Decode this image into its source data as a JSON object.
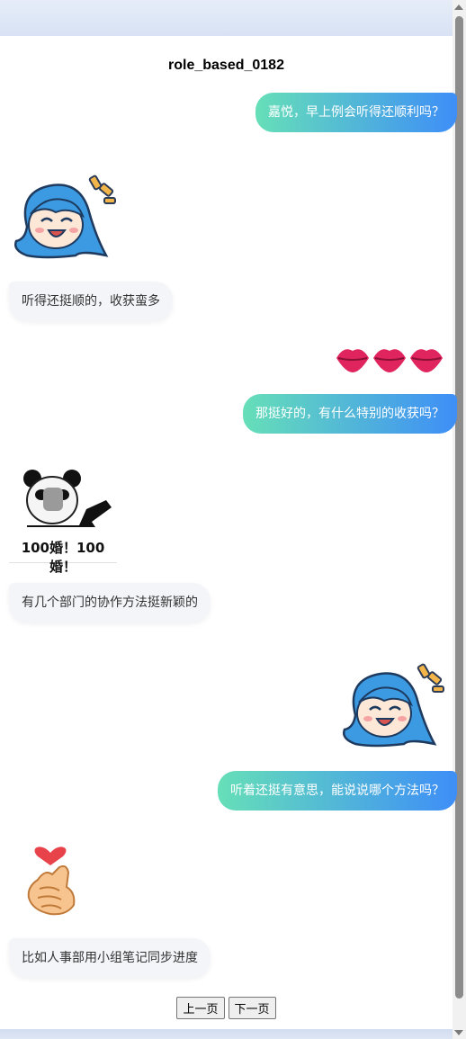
{
  "title": "role_based_0182",
  "messages": {
    "m1": "嘉悦，早上例会听得还顺利吗？",
    "m2": "听得还挺顺的，收获蛮多",
    "m3": "那挺好的，有什么特别的收获吗？",
    "m4": "有几个部门的协作方法挺新颖的",
    "m5": "听着还挺有意思，能说说哪个方法吗？",
    "m6": "比如人事部用小组笔记同步进度"
  },
  "stickers": {
    "anime_girl": "anime-girl-laughing",
    "lips": "kiss-lips",
    "panda_caption": "100婚！100婚！",
    "finger_heart": "finger-heart"
  },
  "pager": {
    "prev": "上一页",
    "next": "下一页"
  },
  "colors": {
    "bubble_gradient_start": "#66dfb8",
    "bubble_gradient_end": "#3e8ef7",
    "left_bubble": "#f3f5f9"
  }
}
